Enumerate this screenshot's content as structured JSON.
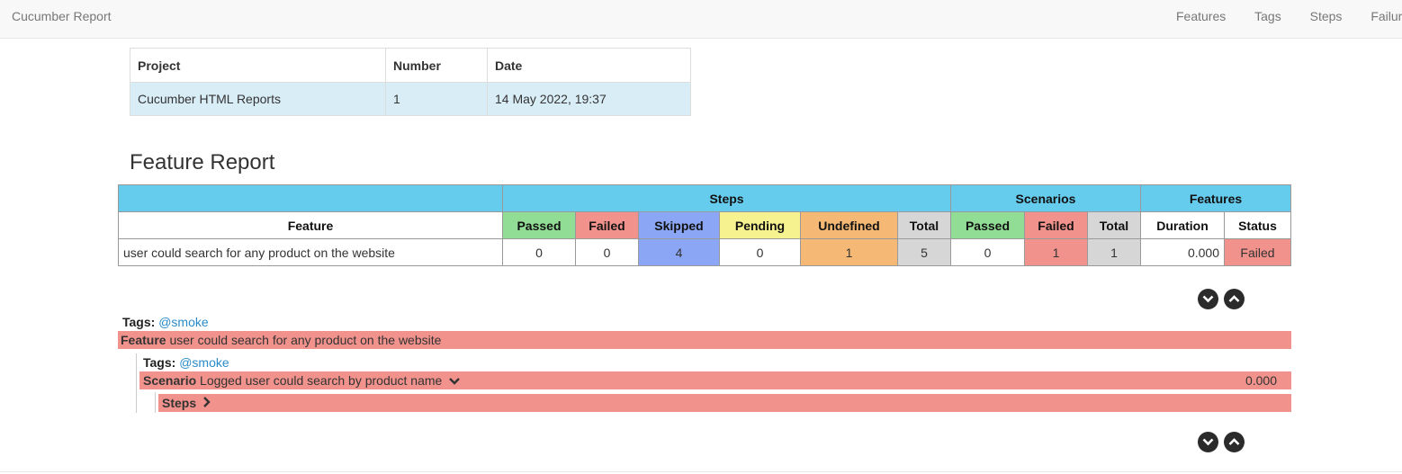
{
  "navbar": {
    "brand": "Cucumber Report",
    "links": [
      "Features",
      "Tags",
      "Steps",
      "Failures"
    ]
  },
  "info_table": {
    "headers": [
      "Project",
      "Number",
      "Date"
    ],
    "row": [
      "Cucumber HTML Reports",
      "1",
      "14 May 2022, 19:37"
    ]
  },
  "feature_report": {
    "title": "Feature Report",
    "groups": {
      "steps": "Steps",
      "scenarios": "Scenarios",
      "features": "Features"
    },
    "columns": {
      "feature": "Feature",
      "steps_passed": "Passed",
      "steps_failed": "Failed",
      "steps_skipped": "Skipped",
      "steps_pending": "Pending",
      "steps_undefined": "Undefined",
      "steps_total": "Total",
      "scen_passed": "Passed",
      "scen_failed": "Failed",
      "scen_total": "Total",
      "duration": "Duration",
      "status": "Status"
    },
    "row": {
      "feature": "user could search for any product on the website",
      "steps_passed": "0",
      "steps_failed": "0",
      "steps_skipped": "4",
      "steps_pending": "0",
      "steps_undefined": "1",
      "steps_total": "5",
      "scen_passed": "0",
      "scen_failed": "1",
      "scen_total": "1",
      "duration": "0.000",
      "status": "Failed"
    }
  },
  "details": {
    "tags_label": "Tags:",
    "feature_tag": "@smoke",
    "feature_keyword": "Feature",
    "feature_name": "user could search for any product on the website",
    "scenario_tag": "@smoke",
    "scenario_keyword": "Scenario",
    "scenario_name": "Logged user could search by product name",
    "scenario_duration": "0.000",
    "steps_label": "Steps"
  },
  "colors": {
    "header_blue": "#66ccee",
    "passed": "#92dd96",
    "failed": "#f2928c",
    "skipped": "#8aa6f5",
    "pending": "#f5f28f",
    "undefined": "#f5b975",
    "total": "#d6d6d6"
  },
  "icons": [
    "expand-all-icon",
    "collapse-all-icon",
    "chevron-down-icon",
    "chevron-right-icon"
  ]
}
